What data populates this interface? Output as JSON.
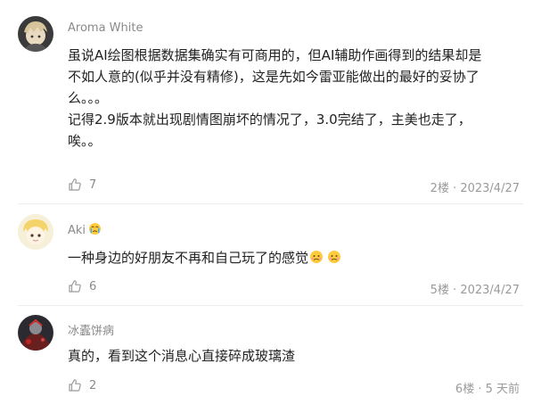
{
  "comments": [
    {
      "author": "Aroma White",
      "content_lines": [
        "虽说AI绘图根据数据集确实有可商用的，但AI辅助作画得到的结果却是",
        "不如人意的(似乎并没有精修)，这是先如今雷亚能做出的最好的妥协了",
        "么。。。",
        "记得2.9版本就出现剧情图崩坏的情况了，3.0完结了，主美也走了，",
        "唉。。"
      ],
      "likes": "7",
      "meta": "2楼 · 2023/4/27",
      "avatar_icon": "anime-avatar-aroma"
    },
    {
      "author": "Aki",
      "author_badge_icon": "crying-emoji-icon",
      "content": "一种身边的好朋友不再和自己玩了的感觉",
      "content_emojis": [
        "sad-emoji-icon",
        "sad-emoji-icon"
      ],
      "likes": "6",
      "meta": "5楼 · 2023/4/27",
      "avatar_icon": "anime-avatar-aki"
    },
    {
      "author": "冰蠹饼病",
      "content": "真的，看到这个消息心直接碎成玻璃渣",
      "likes": "2",
      "meta": "6楼 · 5 天前",
      "avatar_icon": "dark-photo-avatar"
    }
  ],
  "colors": {
    "text": "#222222",
    "secondary": "#8a8a8a",
    "divider": "#ececec"
  }
}
